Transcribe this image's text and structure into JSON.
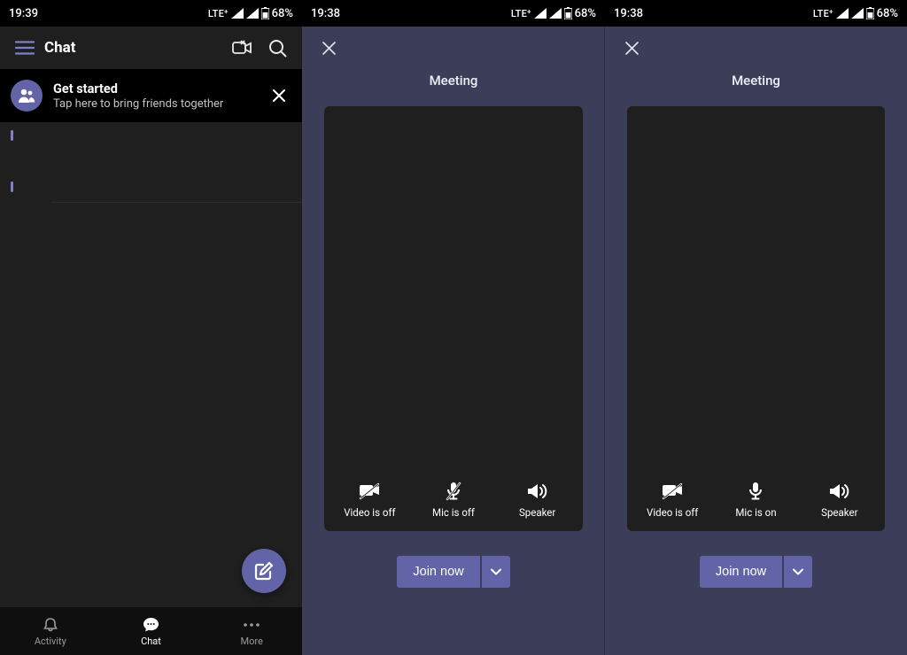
{
  "status": {
    "p1": {
      "time": "19:39",
      "net": "LTE",
      "battery": "68%"
    },
    "p2": {
      "time": "19:38",
      "net": "LTE",
      "battery": "68%"
    },
    "p3": {
      "time": "19:38",
      "net": "LTE",
      "battery": "68%"
    }
  },
  "chat": {
    "title": "Chat",
    "banner": {
      "title": "Get started",
      "subtitle": "Tap here to bring friends together"
    },
    "nav": {
      "activity": "Activity",
      "chat": "Chat",
      "more": "More"
    }
  },
  "meeting": {
    "title": "Meeting",
    "controls": {
      "video_off": "Video is off",
      "mic_off": "Mic is off",
      "mic_on": "Mic is on",
      "speaker": "Speaker"
    },
    "join": "Join now"
  }
}
